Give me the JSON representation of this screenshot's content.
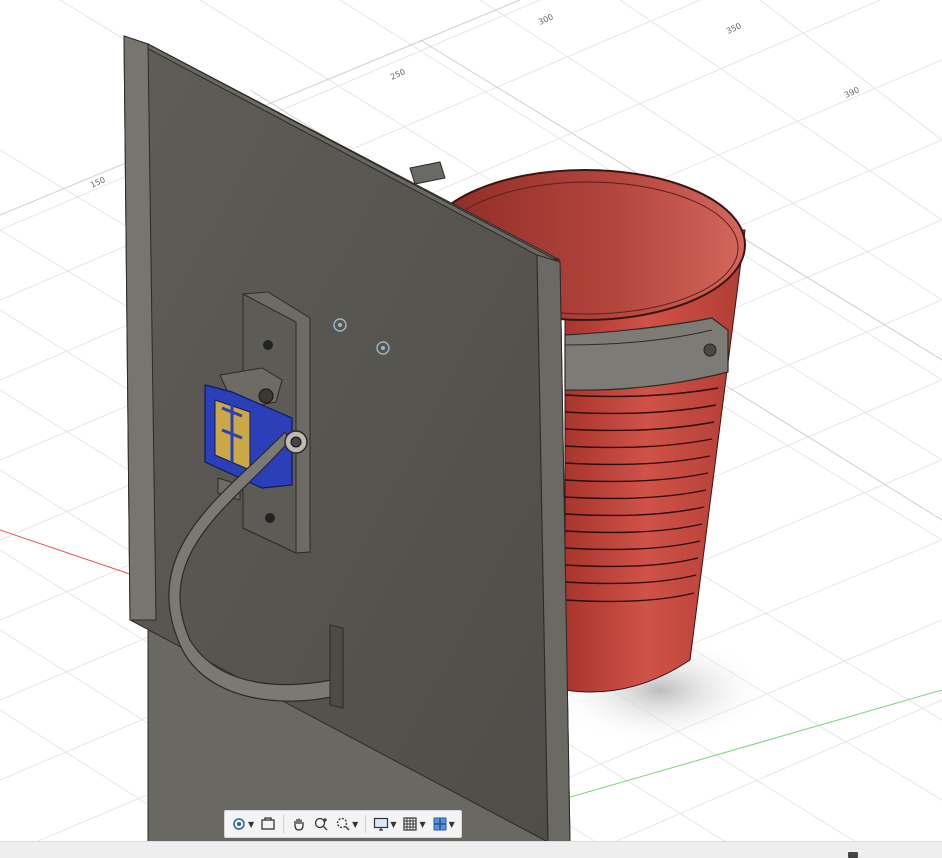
{
  "viewport": {
    "grid_labels": {
      "g150": "150",
      "g250": "250",
      "g300": "300",
      "g350": "350",
      "g390": "390"
    },
    "colors": {
      "background": "#ffffff",
      "grid": "#e3e3e3",
      "x_axis": "#e05a5a",
      "y_axis": "#7cd17c",
      "plate": "#5a5852",
      "cup": "#c4473d",
      "servo": "#2b3fb8"
    }
  },
  "toolbar": {
    "items": [
      {
        "icon": "orbit-icon",
        "has_menu": true
      },
      {
        "icon": "look-at-icon",
        "has_menu": false
      },
      {
        "icon": "pan-hand-icon",
        "has_menu": false
      },
      {
        "icon": "zoom-icon",
        "has_menu": false
      },
      {
        "icon": "fit-icon",
        "has_menu": true
      },
      {
        "icon": "display-settings-icon",
        "has_menu": true
      },
      {
        "icon": "grid-icon",
        "has_menu": true
      },
      {
        "icon": "viewports-icon",
        "has_menu": true
      }
    ]
  }
}
